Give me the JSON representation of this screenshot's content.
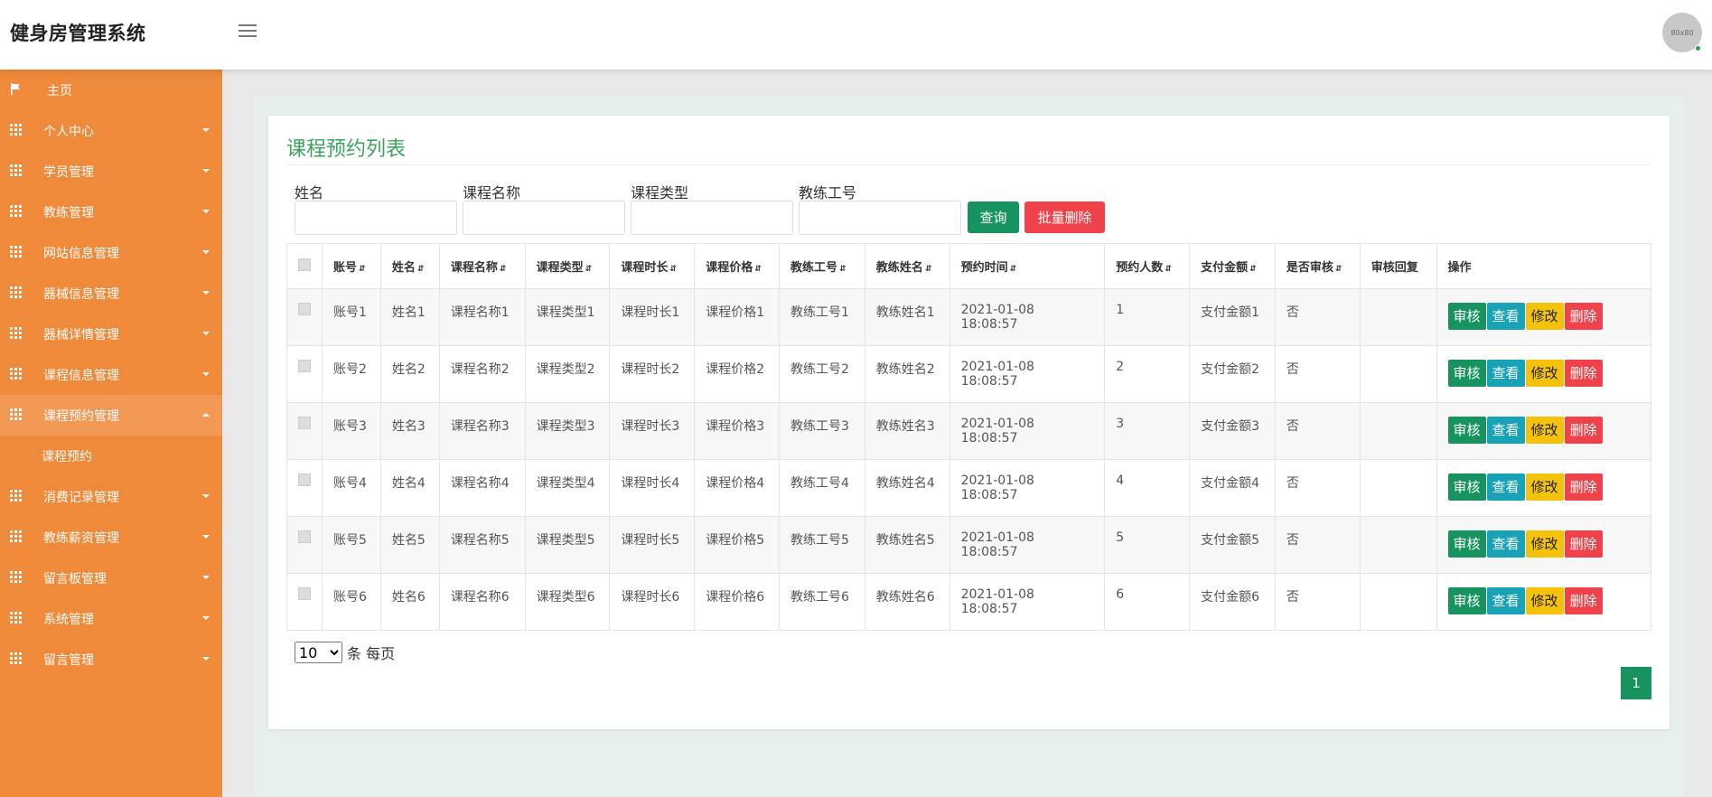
{
  "header": {
    "brand": "健身房管理系统",
    "avatar_text": "80x80"
  },
  "sidebar": {
    "home": "主页",
    "items": [
      {
        "label": "个人中心"
      },
      {
        "label": "学员管理"
      },
      {
        "label": "教练管理"
      },
      {
        "label": "网站信息管理"
      },
      {
        "label": "器械信息管理"
      },
      {
        "label": "器械详情管理"
      },
      {
        "label": "课程信息管理"
      },
      {
        "label": "课程预约管理"
      },
      {
        "label": "消费记录管理"
      },
      {
        "label": "教练薪资管理"
      },
      {
        "label": "留言板管理"
      },
      {
        "label": "系统管理"
      },
      {
        "label": "留言管理"
      }
    ],
    "sub_item": "课程预约"
  },
  "main": {
    "title": "课程预约列表",
    "search": {
      "name_label": "姓名",
      "course_name_label": "课程名称",
      "course_type_label": "课程类型",
      "coach_id_label": "教练工号",
      "query_button": "查询",
      "batch_delete_button": "批量删除"
    },
    "table": {
      "columns": [
        "账号",
        "姓名",
        "课程名称",
        "课程类型",
        "课程时长",
        "课程价格",
        "教练工号",
        "教练姓名",
        "预约时间",
        "预约人数",
        "支付金额",
        "是否审核",
        "审核回复",
        "操作"
      ],
      "rows": [
        {
          "account": "账号1",
          "name": "姓名1",
          "course_name": "课程名称1",
          "course_type": "课程类型1",
          "duration": "课程时长1",
          "price": "课程价格1",
          "coach_id": "教练工号1",
          "coach_name": "教练姓名1",
          "time": "2021-01-08 18:08:57",
          "count": "1",
          "amount": "支付金额1",
          "audited": "否",
          "reply": ""
        },
        {
          "account": "账号2",
          "name": "姓名2",
          "course_name": "课程名称2",
          "course_type": "课程类型2",
          "duration": "课程时长2",
          "price": "课程价格2",
          "coach_id": "教练工号2",
          "coach_name": "教练姓名2",
          "time": "2021-01-08 18:08:57",
          "count": "2",
          "amount": "支付金额2",
          "audited": "否",
          "reply": ""
        },
        {
          "account": "账号3",
          "name": "姓名3",
          "course_name": "课程名称3",
          "course_type": "课程类型3",
          "duration": "课程时长3",
          "price": "课程价格3",
          "coach_id": "教练工号3",
          "coach_name": "教练姓名3",
          "time": "2021-01-08 18:08:57",
          "count": "3",
          "amount": "支付金额3",
          "audited": "否",
          "reply": ""
        },
        {
          "account": "账号4",
          "name": "姓名4",
          "course_name": "课程名称4",
          "course_type": "课程类型4",
          "duration": "课程时长4",
          "price": "课程价格4",
          "coach_id": "教练工号4",
          "coach_name": "教练姓名4",
          "time": "2021-01-08 18:08:57",
          "count": "4",
          "amount": "支付金额4",
          "audited": "否",
          "reply": ""
        },
        {
          "account": "账号5",
          "name": "姓名5",
          "course_name": "课程名称5",
          "course_type": "课程类型5",
          "duration": "课程时长5",
          "price": "课程价格5",
          "coach_id": "教练工号5",
          "coach_name": "教练姓名5",
          "time": "2021-01-08 18:08:57",
          "count": "5",
          "amount": "支付金额5",
          "audited": "否",
          "reply": ""
        },
        {
          "account": "账号6",
          "name": "姓名6",
          "course_name": "课程名称6",
          "course_type": "课程类型6",
          "duration": "课程时长6",
          "price": "课程价格6",
          "coach_id": "教练工号6",
          "coach_name": "教练姓名6",
          "time": "2021-01-08 18:08:57",
          "count": "6",
          "amount": "支付金额6",
          "audited": "否",
          "reply": ""
        }
      ],
      "actions": {
        "audit": "审核",
        "view": "查看",
        "edit": "修改",
        "delete": "删除"
      }
    },
    "pagination": {
      "page_size": "10",
      "page_size_suffix": "条 每页",
      "current_page": "1"
    }
  },
  "colors": {
    "sidebar": "#ef8a3a",
    "primary_green": "#16935e",
    "info": "#17a2b8",
    "warning": "#f5c20b",
    "danger": "#f0424a",
    "title_green": "#3aa55c"
  }
}
